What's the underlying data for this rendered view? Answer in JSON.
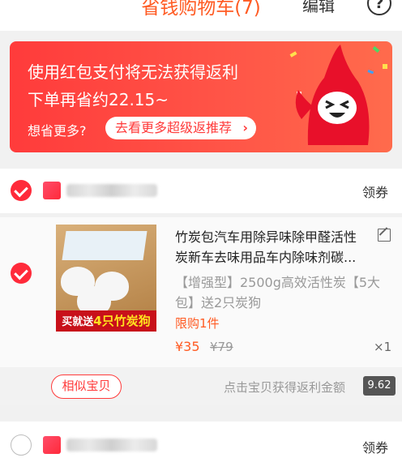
{
  "header": {
    "title": "省钱购物车(7)",
    "edit_label": "编辑",
    "help_icon": "?"
  },
  "banner": {
    "line1": "使用红包支付将无法获得返利",
    "line2": "下单再省约22.15~",
    "line3": "想省更多?",
    "button_label": "去看更多超级返推荐",
    "button_arrow": "›"
  },
  "shops": [
    {
      "checked": true,
      "coupon_label": "领券"
    },
    {
      "checked": false,
      "coupon_label": "领券"
    }
  ],
  "item": {
    "checked": true,
    "image_ribbon_prefix": "买就送",
    "image_ribbon_highlight": "4只竹炭狗",
    "title": "竹炭包汽车用除异味除甲醛活性炭新车去味用品车内除味剂碳...",
    "spec": "【增强型】2500g高效活性炭【5大包】送2只炭狗",
    "limit": "限购1件",
    "price": "¥35",
    "original_price": "¥79",
    "quantity": "×1"
  },
  "actions": {
    "similar_label": "相似宝贝",
    "hint": "点击宝贝获得返利金额",
    "rebate_amount": "9.62"
  },
  "colors": {
    "accent": "#ff3b3b",
    "title": "#ff5b23"
  }
}
